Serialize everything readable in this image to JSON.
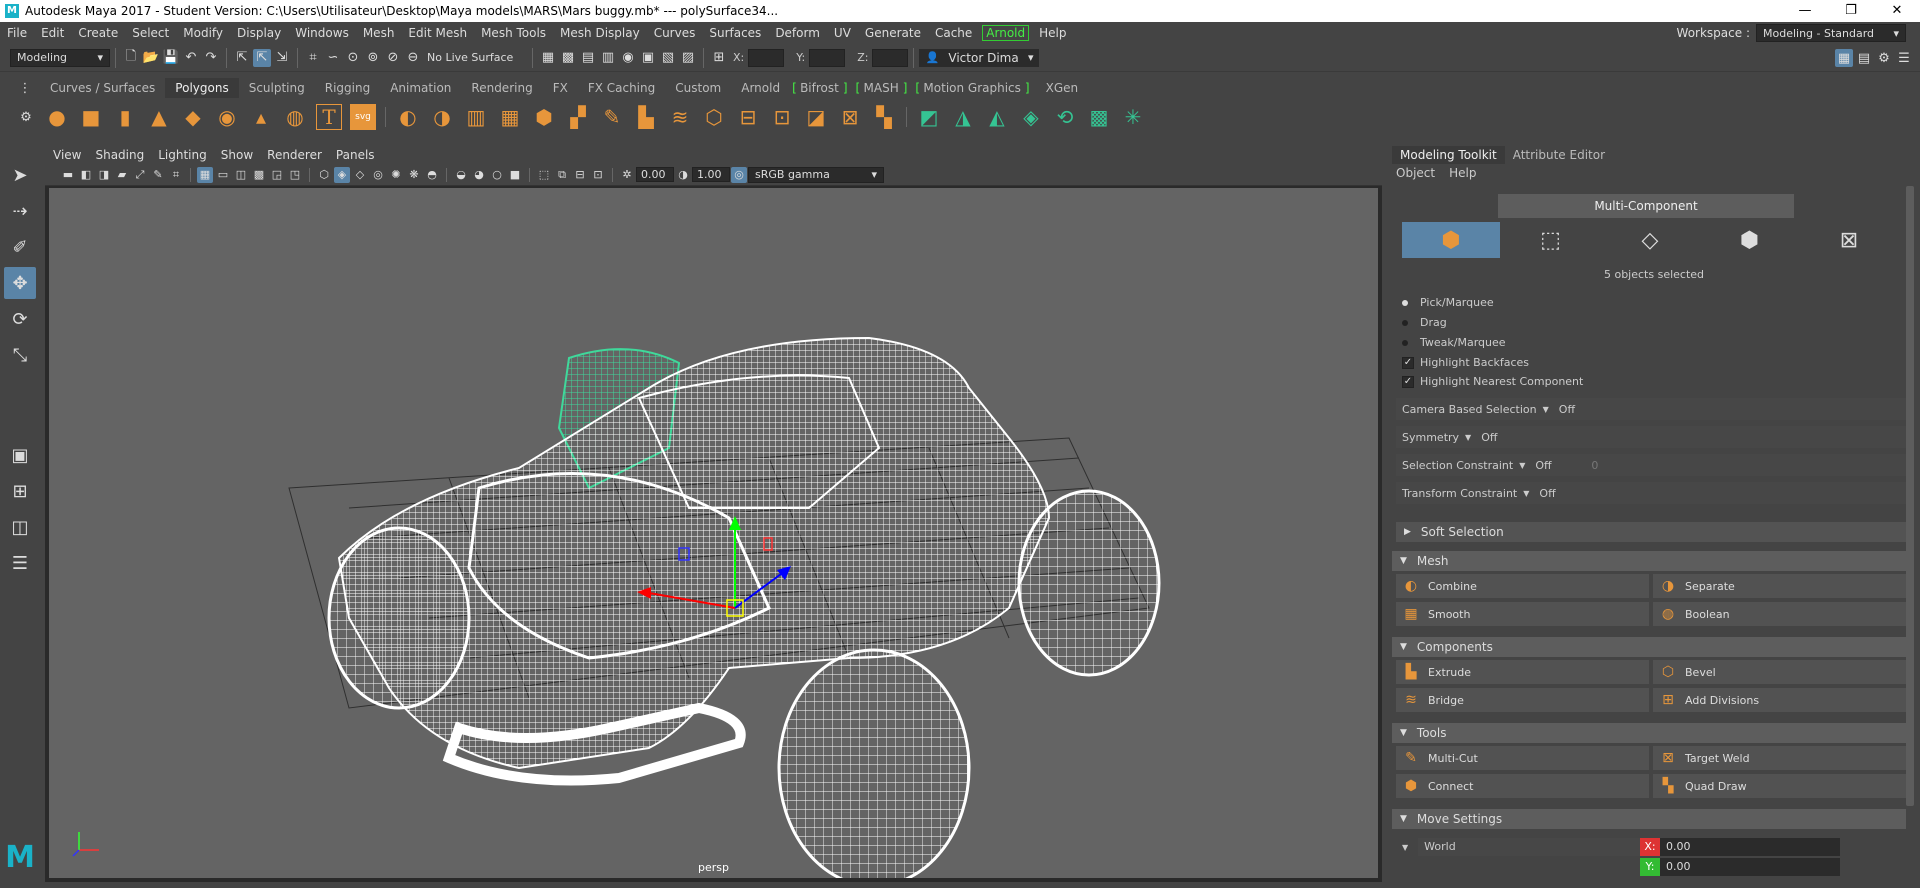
{
  "titlebar": {
    "title": "Autodesk Maya 2017 - Student Version: C:\\Users\\Utilisateur\\Desktop\\Maya models\\MARS\\Mars buggy.mb*   ---   polySurface34...",
    "logo": "M"
  },
  "menubar": {
    "items": [
      "File",
      "Edit",
      "Create",
      "Select",
      "Modify",
      "Display",
      "Windows",
      "Mesh",
      "Edit Mesh",
      "Mesh Tools",
      "Mesh Display",
      "Curves",
      "Surfaces",
      "Deform",
      "UV",
      "Generate",
      "Cache",
      "Arnold",
      "Help"
    ],
    "workspace_label": "Workspace :",
    "workspace_value": "Modeling - Standard"
  },
  "statusline": {
    "mode": "Modeling",
    "live_surface": "No Live Surface",
    "x_label": "X:",
    "y_label": "Y:",
    "z_label": "Z:",
    "user": "Victor Dima"
  },
  "shelf": {
    "tabs": [
      "Curves / Surfaces",
      "Polygons",
      "Sculpting",
      "Rigging",
      "Animation",
      "Rendering",
      "FX",
      "FX Caching",
      "Custom",
      "Arnold",
      "Bifrost",
      "MASH",
      "Motion Graphics",
      "XGen"
    ],
    "active_tab": "Polygons"
  },
  "viewport": {
    "menu": [
      "View",
      "Shading",
      "Lighting",
      "Show",
      "Renderer",
      "Panels"
    ],
    "exposure": "0.00",
    "gamma": "1.00",
    "color_space": "sRGB gamma",
    "camera": "persp"
  },
  "panel": {
    "tabs": [
      "Modeling Toolkit",
      "Attribute Editor"
    ],
    "menu": [
      "Object",
      "Help"
    ],
    "multi_component": "Multi-Component",
    "selected_text": "5 objects selected",
    "pick_options": [
      "Pick/Marquee",
      "Drag",
      "Tweak/Marquee"
    ],
    "checks": [
      "Highlight Backfaces",
      "Highlight Nearest Component"
    ],
    "camera_based_selection": {
      "label": "Camera Based Selection",
      "value": "Off"
    },
    "symmetry": {
      "label": "Symmetry",
      "value": "Off"
    },
    "selection_constraint": {
      "label": "Selection Constraint",
      "value": "Off",
      "extra": "0"
    },
    "transform_constraint": {
      "label": "Transform Constraint",
      "value": "Off"
    },
    "soft_selection": "Soft Selection",
    "mesh_section": "Mesh",
    "mesh_buttons": [
      "Combine",
      "Separate",
      "Smooth",
      "Boolean"
    ],
    "components_section": "Components",
    "component_buttons": [
      "Extrude",
      "Bevel",
      "Bridge",
      "Add Divisions"
    ],
    "tools_section": "Tools",
    "tool_buttons": [
      "Multi-Cut",
      "Target Weld",
      "Connect",
      "Quad Draw"
    ],
    "move_settings": "Move Settings",
    "space": "World",
    "x_label": "X:",
    "x_value": "0.00",
    "y_label": "Y:",
    "y_value": "0.00"
  }
}
